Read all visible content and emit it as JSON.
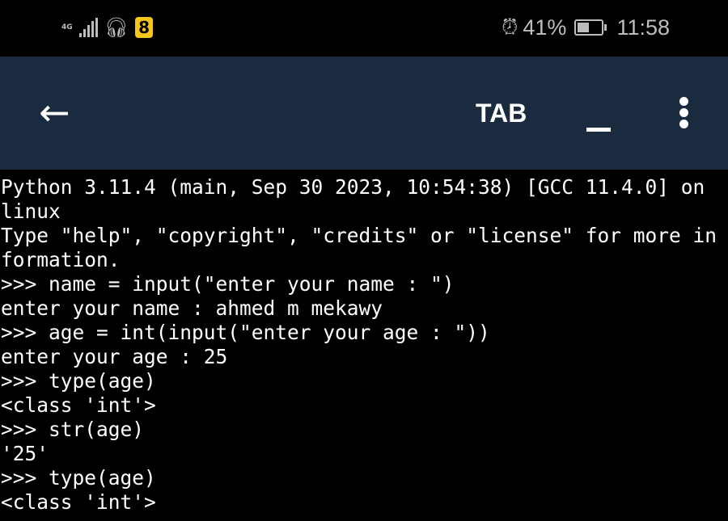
{
  "status_bar": {
    "network": "4G",
    "badge": "8",
    "alarm_icon": "alarm-icon",
    "battery_percent": "41%",
    "battery_level": 41,
    "time": "11:58"
  },
  "app_bar": {
    "back_icon": "arrow-left-icon",
    "title": "TAB",
    "minimize_icon": "minimize-icon",
    "menu_icon": "more-vertical-icon",
    "background": "#1a2b3f"
  },
  "terminal": {
    "lines": [
      "Python 3.11.4 (main, Sep 30 2023, 10:54:38) [GCC 11.4.0] on",
      "linux",
      "Type \"help\", \"copyright\", \"credits\" or \"license\" for more in",
      "formation.",
      ">>> name = input(\"enter your name : \")",
      "enter your name : ahmed m mekawy",
      ">>> age = int(input(\"enter your age : \"))",
      "enter your age : 25",
      ">>> type(age)",
      "<class 'int'>",
      ">>> str(age)",
      "'25'",
      ">>> type(age)",
      "<class 'int'>"
    ]
  }
}
